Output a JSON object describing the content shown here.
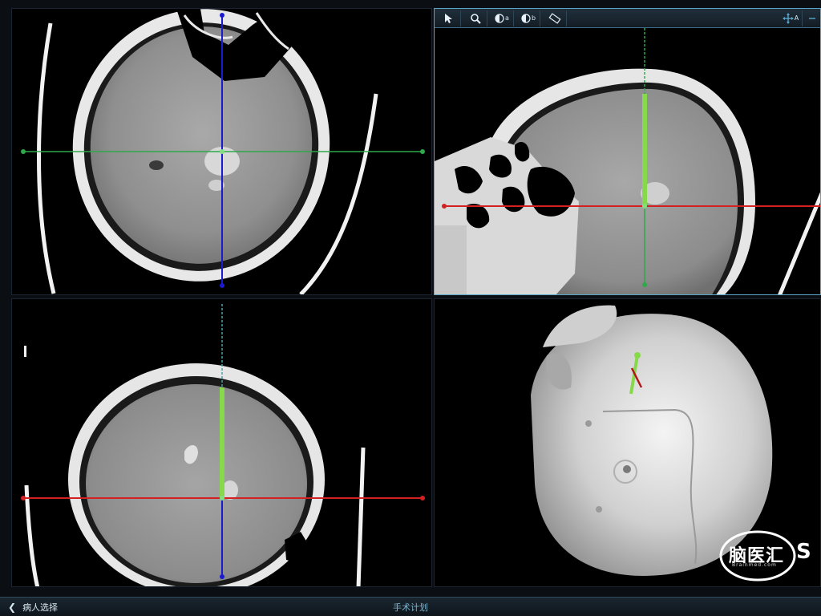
{
  "statusbar": {
    "back_label": "病人选择",
    "title": "手术计划"
  },
  "sagittal_toolbar": {
    "tools": [
      {
        "icon": "pointer-icon"
      },
      {
        "icon": "zoom-icon"
      },
      {
        "icon": "contrast-a-icon",
        "sub": "a"
      },
      {
        "icon": "contrast-b-icon",
        "sub": "b"
      },
      {
        "icon": "ruler-icon"
      },
      {
        "icon": "pan-icon",
        "sub": "A"
      }
    ]
  },
  "watermark": {
    "text": "脑医汇",
    "sub": "Brainmed.com",
    "tail": "S"
  },
  "colors": {
    "crosshair_green": "#2fa84a",
    "crosshair_red": "#d42020",
    "crosshair_blue": "#1a1ad0",
    "trajectory": "#86d94a",
    "accent": "#5aa6c8"
  }
}
